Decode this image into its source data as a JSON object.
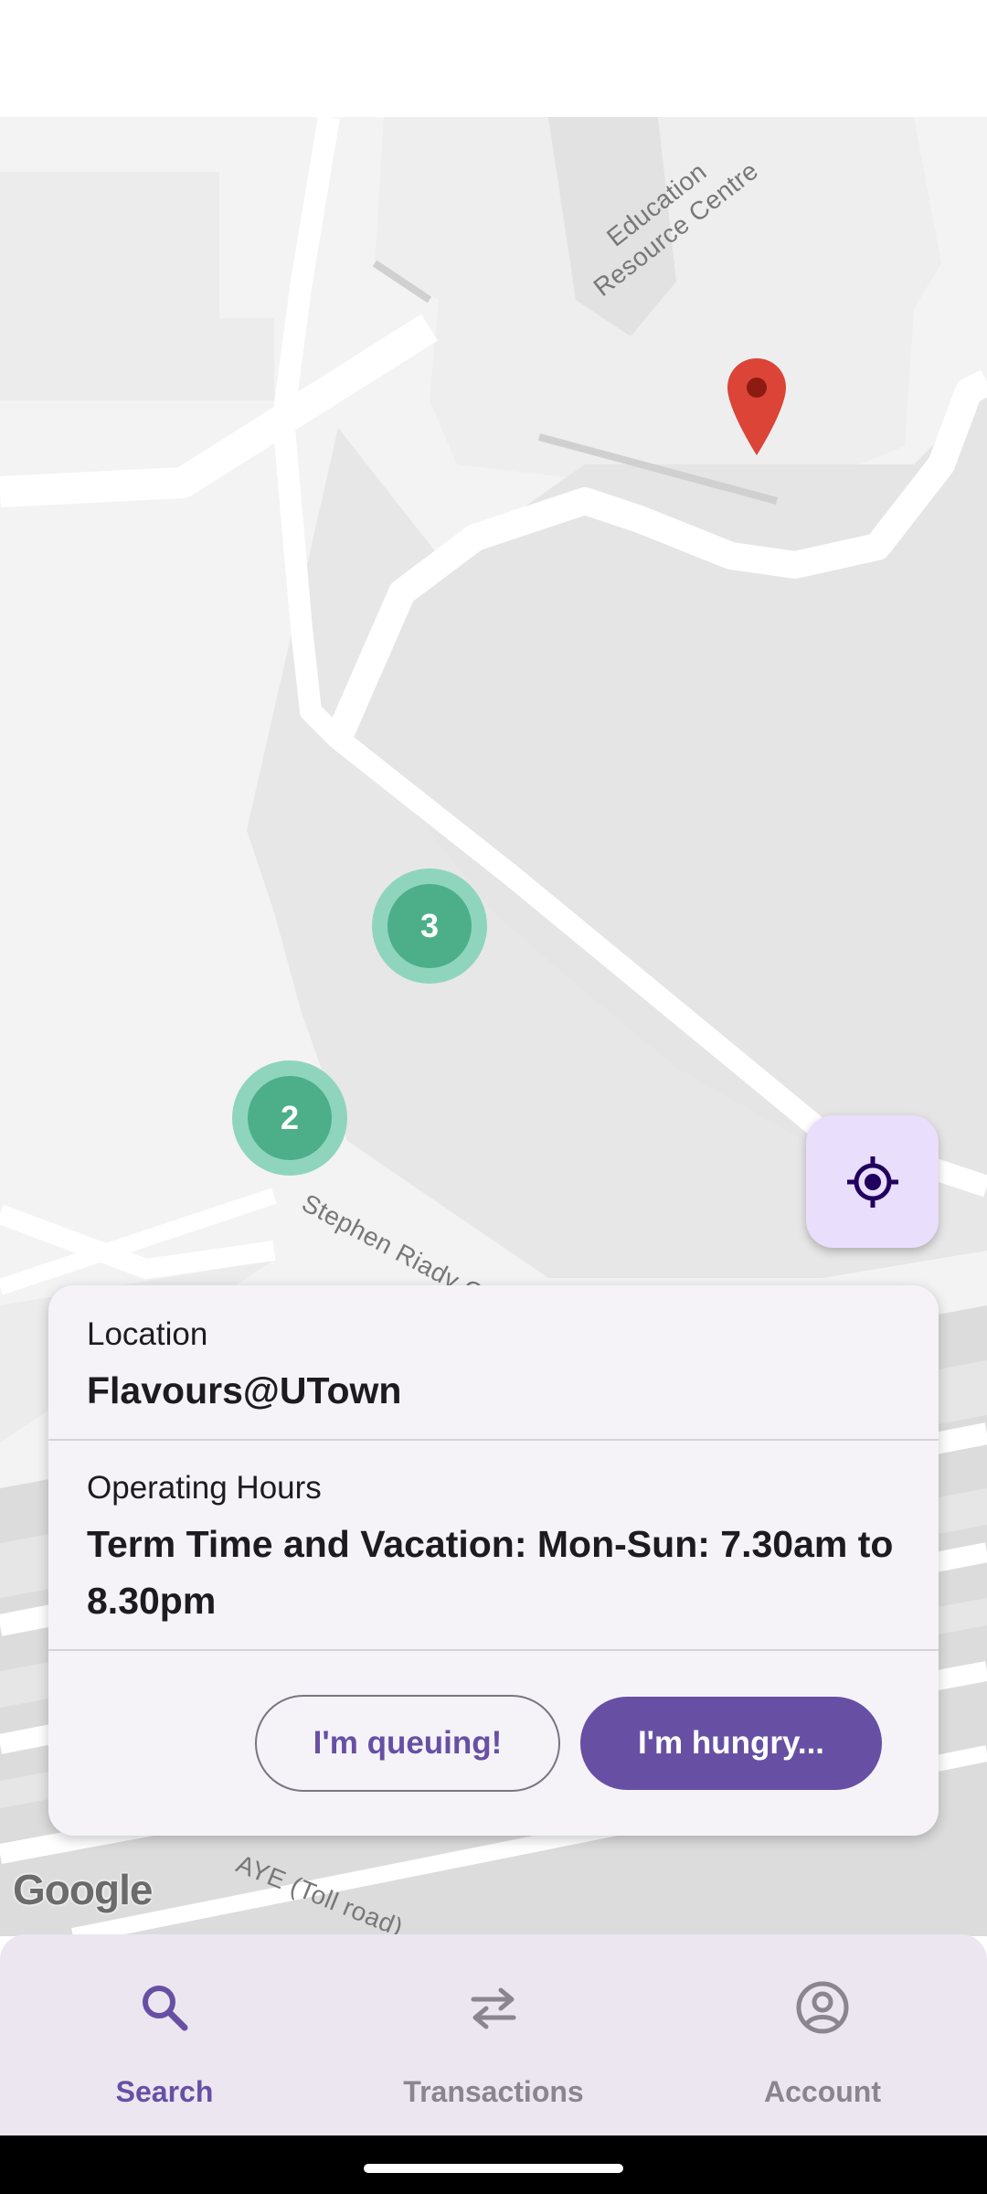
{
  "map": {
    "labels": {
      "education": "Education\nResource Centre",
      "stephen": "Stephen Riady Cen",
      "aye": "AYE (Toll road)"
    },
    "clusters": [
      "3",
      "2"
    ],
    "attribution": "Google",
    "pin_icon": "map-pin-icon",
    "locate_icon": "my-location-icon",
    "colors": {
      "cluster_inner": "#4caf8a",
      "cluster_outer": "#8fd5bd",
      "pin": "#db4437"
    }
  },
  "card": {
    "location_label": "Location",
    "location_value": "Flavours@UTown",
    "hours_label": "Operating Hours",
    "hours_value": "Term Time and Vacation: Mon-Sun: 7.30am to 8.30pm",
    "queue_button": "I'm queuing!",
    "hungry_button": "I'm hungry..."
  },
  "nav": {
    "items": [
      {
        "label": "Search",
        "icon": "search-icon",
        "active": true
      },
      {
        "label": "Transactions",
        "icon": "swap-arrows-icon",
        "active": false
      },
      {
        "label": "Account",
        "icon": "account-circle-icon",
        "active": false
      }
    ]
  },
  "colors": {
    "accent": "#6750a4",
    "nav_bg": "#ece6f0",
    "card_bg": "#f5f3f8"
  }
}
